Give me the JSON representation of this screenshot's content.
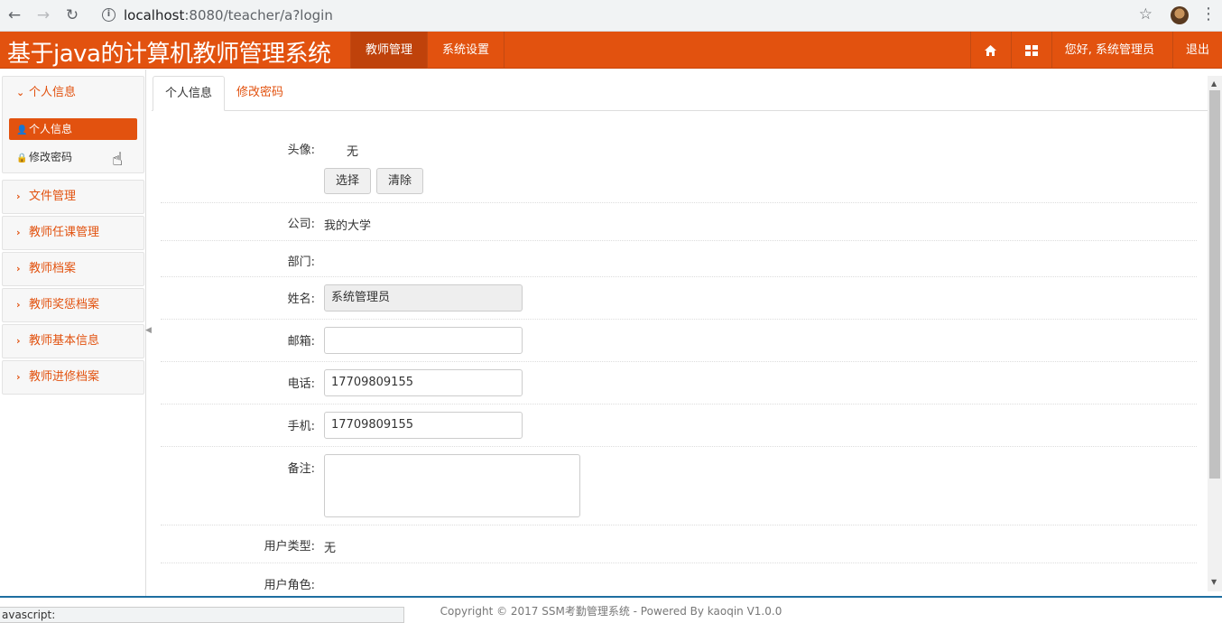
{
  "browser": {
    "url_host": "localhost",
    "url_path": ":8080/teacher/a?login"
  },
  "header": {
    "brand": "基于java的计算机教师管理系统",
    "nav": [
      "教师管理",
      "系统设置"
    ],
    "greeting": "您好, 系统管理员",
    "logout": "退出"
  },
  "sidebar": {
    "groups": [
      {
        "label": "个人信息",
        "expanded": true,
        "items": [
          {
            "label": "个人信息",
            "icon": "user-icon",
            "active": true
          },
          {
            "label": "修改密码",
            "icon": "lock-icon",
            "active": false
          }
        ]
      },
      {
        "label": "文件管理"
      },
      {
        "label": "教师任课管理"
      },
      {
        "label": "教师档案"
      },
      {
        "label": "教师奖惩档案"
      },
      {
        "label": "教师基本信息"
      },
      {
        "label": "教师进修档案"
      }
    ]
  },
  "tabs": [
    "个人信息",
    "修改密码"
  ],
  "form": {
    "avatar_label": "头像:",
    "avatar_value": "无",
    "select_button": "选择",
    "clear_button": "清除",
    "company_label": "公司:",
    "company_value": "我的大学",
    "dept_label": "部门:",
    "name_label": "姓名:",
    "name_value": "系统管理员",
    "email_label": "邮箱:",
    "email_value": "",
    "phone_label": "电话:",
    "phone_value": "17709809155",
    "mobile_label": "手机:",
    "mobile_value": "17709809155",
    "remark_label": "备注:",
    "usertype_label": "用户类型:",
    "usertype_value": "无",
    "role_label": "用户角色:"
  },
  "footer": {
    "copyright": "Copyright © 2017 SSM考勤管理系统 - Powered By kaoqin V1.0.0"
  },
  "statusbar": "avascript:"
}
